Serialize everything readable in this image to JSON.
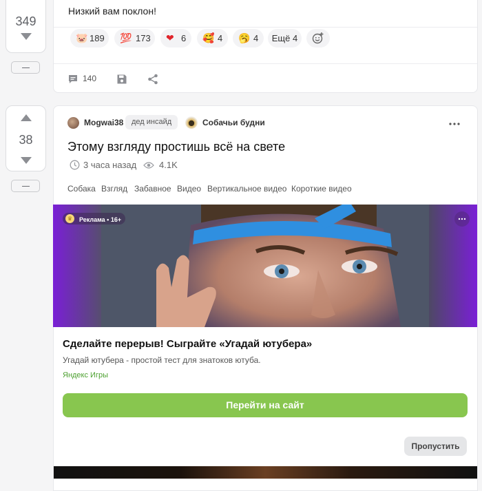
{
  "post1": {
    "vote_count": "349",
    "text": "Низкий вам поклон!",
    "reactions": [
      {
        "icon": "🐷",
        "icon_name": "pig-face-icon",
        "count": "189"
      },
      {
        "icon": "💯",
        "icon_name": "hundred-points-icon",
        "count": "173"
      },
      {
        "icon": "❤",
        "icon_name": "red-heart-icon",
        "count": "6"
      },
      {
        "icon": "🥰",
        "icon_name": "smiling-hearts-icon",
        "count": "4"
      },
      {
        "icon": "🥱",
        "icon_name": "yawning-face-icon",
        "count": "4"
      }
    ],
    "more_reactions": "Ещё 4",
    "comments_count": "140"
  },
  "post2": {
    "vote_count": "38",
    "author": "Mogwai38",
    "author_badge": "дед инсайд",
    "community": "Собачьи будни",
    "title": "Этому взгляду простишь всё на свете",
    "time": "3 часа назад",
    "views": "4.1K",
    "tags": [
      "Собака",
      "Взгляд",
      "Забавное",
      "Видео",
      "Вертикальное видео",
      "Короткие видео"
    ]
  },
  "ad": {
    "label": "Реклама • 16+",
    "title": "Сделайте перерыв! Сыграйте «Угадай ютубера»",
    "description": "Угадай ютубера - простой тест для знатоков ютуба.",
    "source": "Яндекс Игры",
    "cta": "Перейти на сайт",
    "skip": "Пропустить"
  },
  "colors": {
    "accent_green": "#88c64f",
    "ad_purple": "#7a1fd6",
    "source_green": "#4ca02f"
  }
}
